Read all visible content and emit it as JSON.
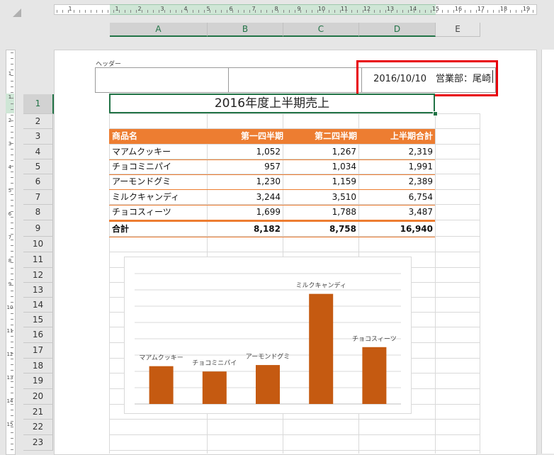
{
  "ruler": {
    "h_numbers": [
      "1",
      "1",
      "2",
      "3",
      "4",
      "5",
      "6",
      "7",
      "8",
      "9",
      "10",
      "11",
      "12",
      "13",
      "14",
      "15",
      "16",
      "17",
      "18",
      "19"
    ],
    "v_numbers": [
      "1",
      "1",
      "2",
      "3",
      "4",
      "5",
      "6",
      "7",
      "8",
      "9",
      "10",
      "11",
      "12",
      "13",
      "14",
      "15"
    ]
  },
  "columns": [
    "A",
    "B",
    "C",
    "D",
    "E"
  ],
  "rows": [
    "1",
    "2",
    "3",
    "4",
    "5",
    "6",
    "7",
    "8",
    "9",
    "10",
    "11",
    "12",
    "13",
    "14",
    "15",
    "16",
    "17",
    "18",
    "19",
    "20",
    "21",
    "22",
    "23"
  ],
  "header_area": {
    "label": "ヘッダー",
    "right_text": "2016/10/10　営業部：尾崎"
  },
  "title": "2016年度上半期売上",
  "table": {
    "headers": [
      "商品名",
      "第一四半期",
      "第二四半期",
      "上半期合計"
    ],
    "rows": [
      [
        "マアムクッキー",
        "1,052",
        "1,267",
        "2,319"
      ],
      [
        "チョコミニパイ",
        "957",
        "1,034",
        "1,991"
      ],
      [
        "アーモンドグミ",
        "1,230",
        "1,159",
        "2,389"
      ],
      [
        "ミルクキャンディ",
        "3,244",
        "3,510",
        "6,754"
      ],
      [
        "チョコスィーツ",
        "1,699",
        "1,788",
        "3,487"
      ]
    ],
    "total": [
      "合計",
      "8,182",
      "8,758",
      "16,940"
    ]
  },
  "chart_data": {
    "type": "bar",
    "categories": [
      "マアムクッキー",
      "チョコミニパイ",
      "アーモンドグミ",
      "ミルクキャンディ",
      "チョコスィーツ"
    ],
    "values": [
      2319,
      1991,
      2389,
      6754,
      3487
    ],
    "bar_color": "#c55a11",
    "grid": true,
    "legend": "none",
    "ylim": [
      0,
      8000
    ]
  },
  "colors": {
    "accent": "#ed7d31",
    "selection": "#217346",
    "highlight_box": "#e8000b"
  }
}
